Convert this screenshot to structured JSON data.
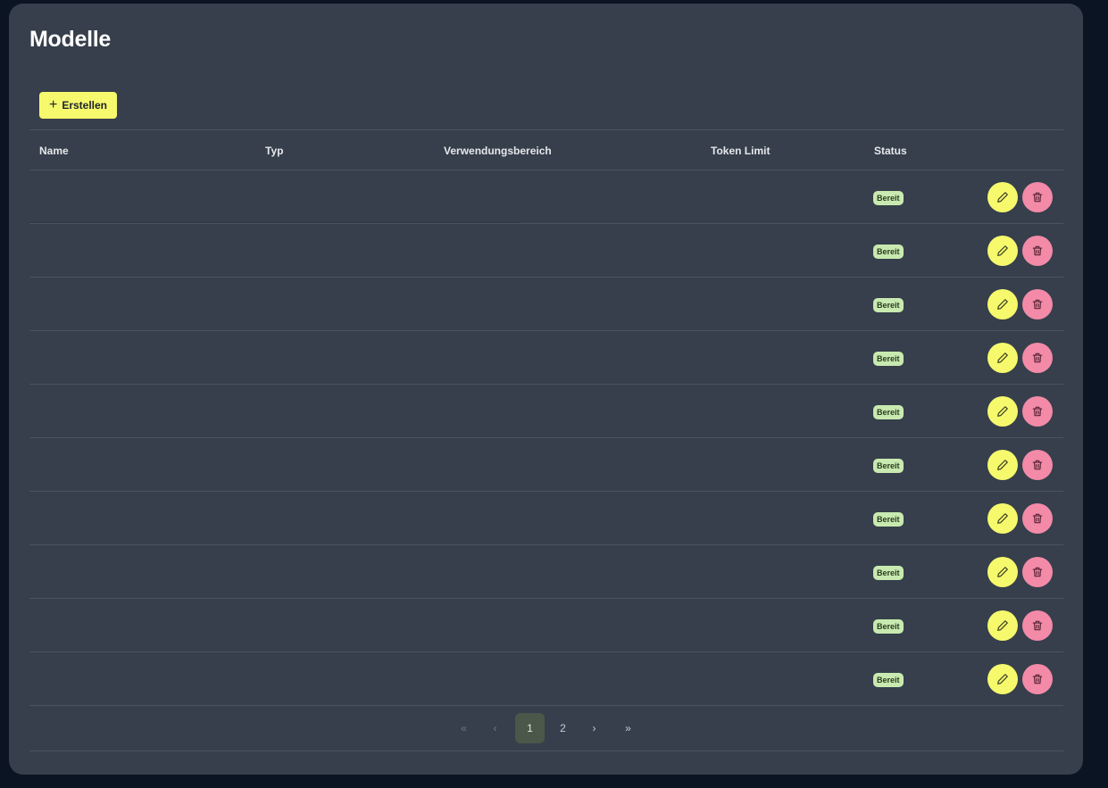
{
  "page": {
    "title": "Modelle",
    "create_label": "Erstellen",
    "colors": {
      "background": "#0b1422",
      "card": "#363f4b",
      "accent_yellow": "#f6f96c",
      "accent_pink": "#f28aa8",
      "status_badge": "#c8eab0"
    }
  },
  "table": {
    "headers": {
      "name": "Name",
      "type": "Typ",
      "usage": "Verwendungsbereich",
      "token_limit": "Token Limit",
      "status": "Status"
    },
    "rows": [
      {
        "name": "",
        "type": "",
        "usage": "",
        "token_limit": "",
        "status": "Bereit"
      },
      {
        "name": "",
        "type": "",
        "usage": "",
        "token_limit": "",
        "status": "Bereit"
      },
      {
        "name": "",
        "type": "",
        "usage": "",
        "token_limit": "",
        "status": "Bereit"
      },
      {
        "name": "",
        "type": "",
        "usage": "",
        "token_limit": "",
        "status": "Bereit"
      },
      {
        "name": "",
        "type": "",
        "usage": "",
        "token_limit": "",
        "status": "Bereit"
      },
      {
        "name": "",
        "type": "",
        "usage": "",
        "token_limit": "",
        "status": "Bereit"
      },
      {
        "name": "",
        "type": "",
        "usage": "",
        "token_limit": "",
        "status": "Bereit"
      },
      {
        "name": "",
        "type": "",
        "usage": "",
        "token_limit": "",
        "status": "Bereit"
      },
      {
        "name": "",
        "type": "",
        "usage": "",
        "token_limit": "",
        "status": "Bereit"
      },
      {
        "name": "",
        "type": "",
        "usage": "",
        "token_limit": "",
        "status": "Bereit"
      }
    ],
    "row_icons": {
      "edit": "pencil-icon",
      "delete": "trash-icon"
    }
  },
  "pagination": {
    "first": "«",
    "prev": "‹",
    "pages": [
      "1",
      "2"
    ],
    "current": "1",
    "next": "›",
    "last": "»"
  }
}
